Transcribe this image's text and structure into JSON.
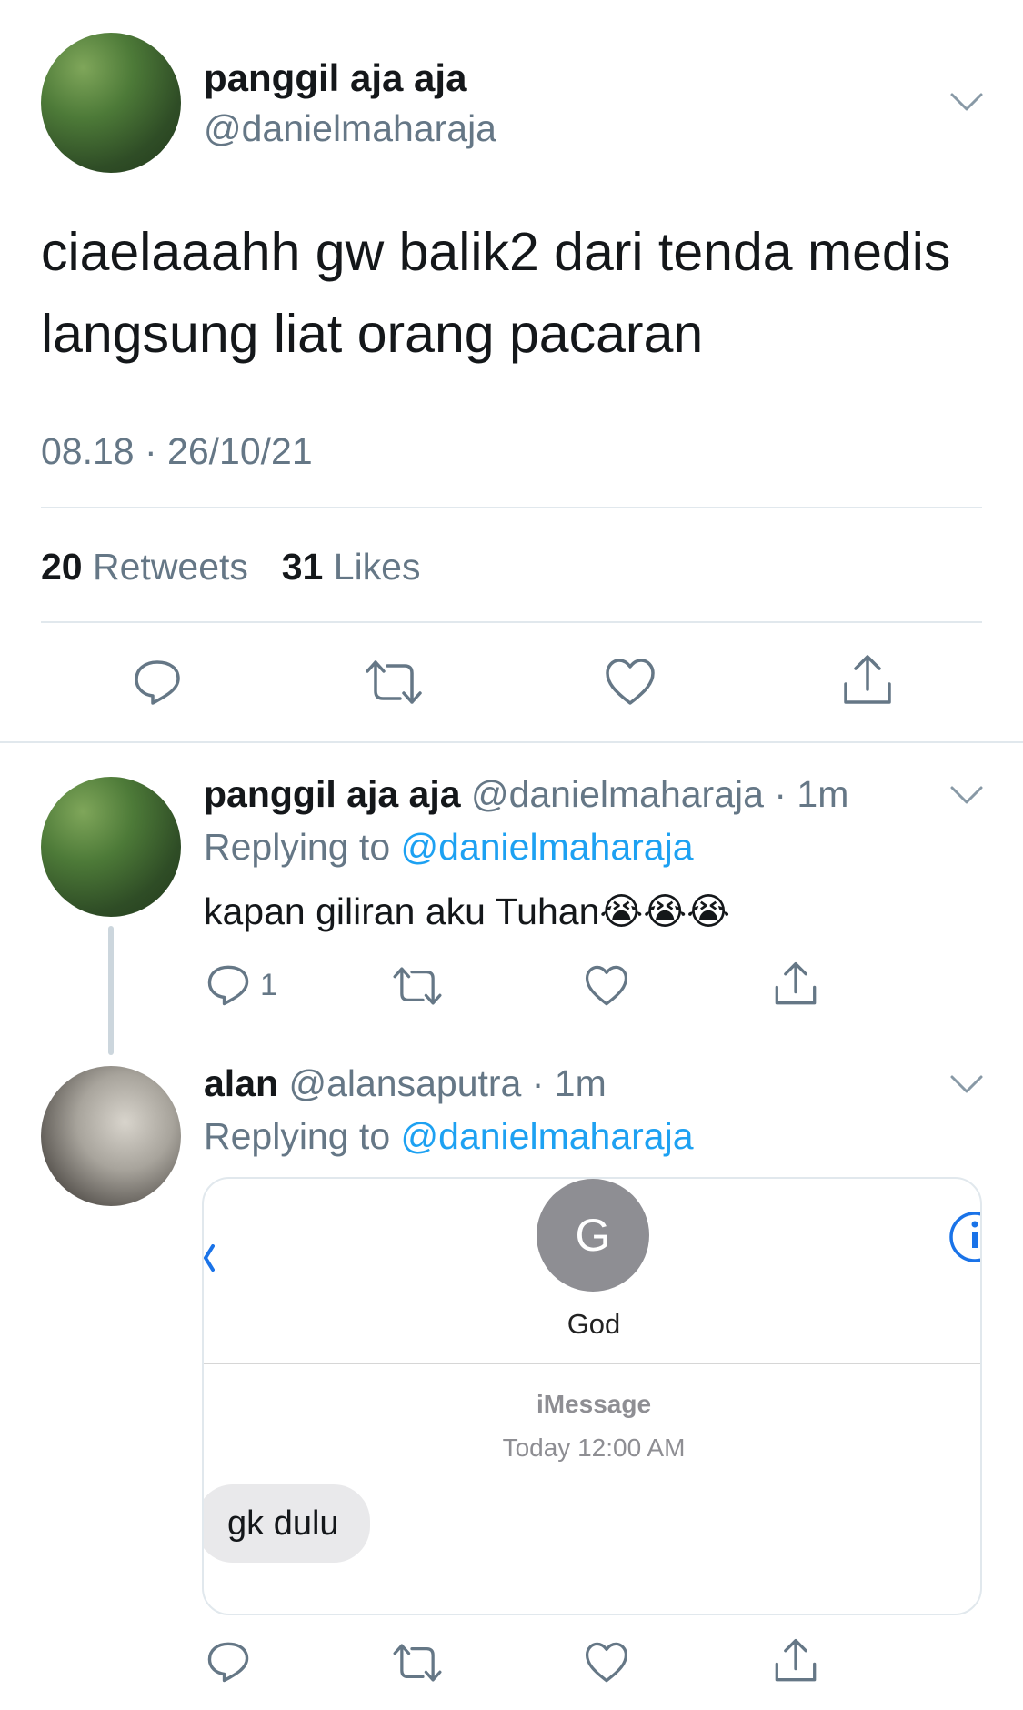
{
  "main_tweet": {
    "display_name": "panggil aja aja",
    "handle": "@danielmaharaja",
    "text_line1": "ciaelaaahh gw balik2 dari tenda medis",
    "text_line2": "langsung liat orang pacaran",
    "timestamp": "08.18 · 26/10/21",
    "retweets_count": "20",
    "retweets_label": "Retweets",
    "likes_count": "31",
    "likes_label": "Likes"
  },
  "reply1": {
    "display_name": "panggil aja aja",
    "handle": "@danielmaharaja",
    "time": "· 1m",
    "replying_to_label": "Replying to",
    "replying_to_handle": "@danielmaharaja",
    "text": "kapan giliran aku Tuhan😭😭😭",
    "reply_count": "1"
  },
  "reply2": {
    "display_name": "alan",
    "handle": "@alansaputra",
    "time": "· 1m",
    "replying_to_label": "Replying to",
    "replying_to_handle": "@danielmaharaja",
    "embed": {
      "contact_initial": "G",
      "contact_name": "God",
      "service": "iMessage",
      "time": "Today 12:00 AM",
      "message": "gk dulu"
    }
  },
  "icons": {
    "reply": "reply-icon",
    "retweet": "retweet-icon",
    "like": "heart-icon",
    "share": "share-icon",
    "menu": "chevron-down-icon"
  },
  "colors": {
    "text": "#14171a",
    "muted": "#657786",
    "link": "#1da1f2",
    "divider": "#e1e8ed"
  }
}
